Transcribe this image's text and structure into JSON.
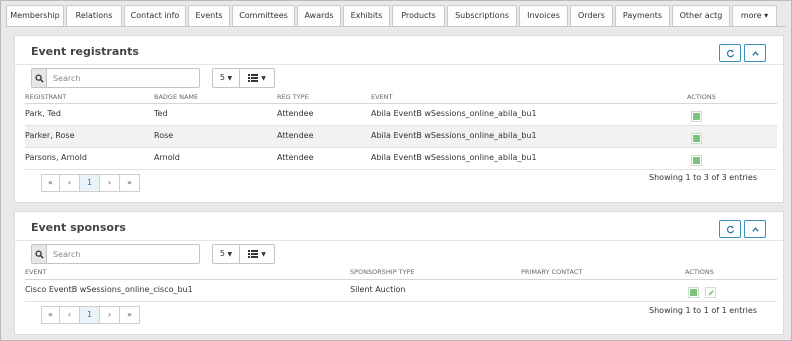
{
  "tabs": [
    {
      "label": "Membership",
      "w": 58
    },
    {
      "label": "Relations",
      "w": 56
    },
    {
      "label": "Contact info",
      "w": 62
    },
    {
      "label": "Events",
      "w": 42
    },
    {
      "label": "Committees",
      "w": 63
    },
    {
      "label": "Awards",
      "w": 44
    },
    {
      "label": "Exhibits",
      "w": 47
    },
    {
      "label": "Products",
      "w": 53
    },
    {
      "label": "Subscriptions",
      "w": 70
    },
    {
      "label": "Invoices",
      "w": 49
    },
    {
      "label": "Orders",
      "w": 43
    },
    {
      "label": "Payments",
      "w": 55
    },
    {
      "label": "Other actg",
      "w": 58
    },
    {
      "label": "more ▾",
      "w": 45
    }
  ],
  "registrants": {
    "title": "Event registrants",
    "search_placeholder": "Search",
    "page_size": "5",
    "columns": [
      "REGISTRANT",
      "BADGE NAME",
      "REG TYPE",
      "EVENT",
      "ACTIONS"
    ],
    "rows": [
      {
        "registrant": "Park, Ted",
        "badge": "Ted",
        "reg_type": "Attendee",
        "event": "Abila EventB wSessions_online_abila_bu1"
      },
      {
        "registrant": "Parker, Rose",
        "badge": "Rose",
        "reg_type": "Attendee",
        "event": "Abila EventB wSessions_online_abila_bu1"
      },
      {
        "registrant": "Parsons, Arnold",
        "badge": "Arnold",
        "reg_type": "Attendee",
        "event": "Abila EventB wSessions_online_abila_bu1"
      }
    ],
    "pager": [
      "«",
      "‹",
      "1",
      "›",
      "»"
    ],
    "showing": "Showing 1 to 3 of 3 entries"
  },
  "sponsors": {
    "title": "Event sponsors",
    "search_placeholder": "Search",
    "page_size": "5",
    "columns": [
      "EVENT",
      "SPONSORSHIP TYPE",
      "PRIMARY CONTACT",
      "ACTIONS"
    ],
    "rows": [
      {
        "event": "Cisco EventB wSessions_online_cisco_bu1",
        "type": "Silent Auction",
        "contact": ""
      }
    ],
    "pager": [
      "«",
      "‹",
      "1",
      "›",
      "»"
    ],
    "showing": "Showing 1 to 1 of 1 entries"
  },
  "icons": {
    "refresh": "refresh-icon",
    "collapse": "chevron-up-icon",
    "search": "search-icon",
    "list": "list-view-icon",
    "view": "view-icon",
    "edit": "pencil-icon"
  },
  "colors": {
    "accent": "#2b7ea9",
    "action_green": "#7cc27c"
  }
}
